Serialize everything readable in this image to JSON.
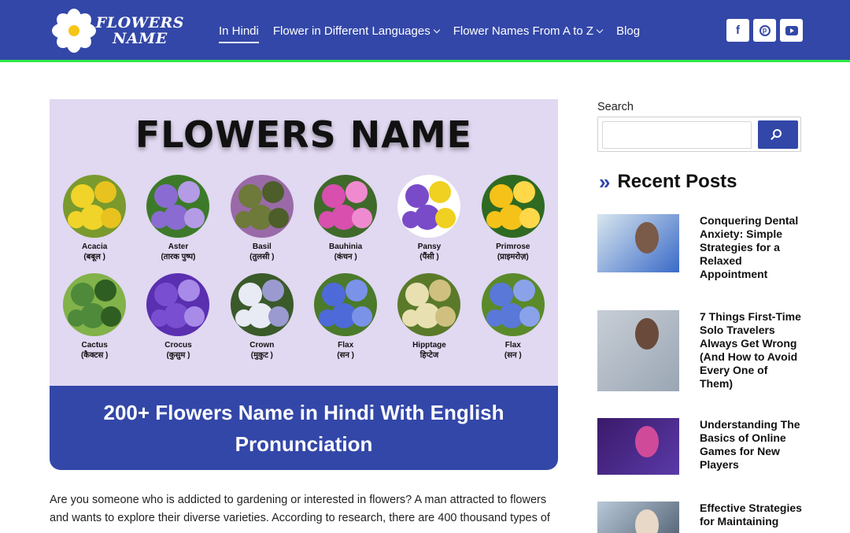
{
  "site": {
    "logo_line1": "FLOWERS",
    "logo_line2": "NAME"
  },
  "nav": {
    "items": [
      {
        "label": "In Hindi",
        "active": true,
        "dropdown": false
      },
      {
        "label": "Flower in Different Languages",
        "dropdown": true
      },
      {
        "label": "Flower Names From A to Z",
        "dropdown": true
      },
      {
        "label": "Blog",
        "dropdown": false
      }
    ]
  },
  "socials": [
    {
      "name": "facebook",
      "glyph": "f"
    },
    {
      "name": "pinterest",
      "glyph": "p"
    },
    {
      "name": "youtube",
      "glyph": ""
    }
  ],
  "hero": {
    "title": "FLOWERS NAME",
    "rows": [
      [
        {
          "name": "Acacia",
          "hindi": "(बबूल )",
          "colors": [
            "#f0d42a",
            "#7a9a2e",
            "#e8c21e"
          ]
        },
        {
          "name": "Aster",
          "hindi": "(तारक पुष्प)",
          "colors": [
            "#8a6bd1",
            "#3c7a2a",
            "#b49be6"
          ]
        },
        {
          "name": "Basil",
          "hindi": "(तुलसी )",
          "colors": [
            "#6d7a3a",
            "#9a6aa8",
            "#4d5e2a"
          ]
        },
        {
          "name": "Bauhinia",
          "hindi": "(कंचन )",
          "colors": [
            "#d84fae",
            "#3f6a2a",
            "#f08ad0"
          ]
        },
        {
          "name": "Pansy",
          "hindi": "(पैंसी )",
          "colors": [
            "#7a4bc8",
            "#ffffff",
            "#f0d020"
          ]
        },
        {
          "name": "Primrose",
          "hindi": "(प्राइमरोज़)",
          "colors": [
            "#f5c21a",
            "#2f6a22",
            "#ffd84a"
          ]
        }
      ],
      [
        {
          "name": "Cactus",
          "hindi": "(कैक्टस )",
          "colors": [
            "#4e8a3a",
            "#82b24a",
            "#2f5e22"
          ]
        },
        {
          "name": "Crocus",
          "hindi": "(कुसुम )",
          "colors": [
            "#7a4ed0",
            "#5a2fb0",
            "#a88ae8"
          ]
        },
        {
          "name": "Crown",
          "hindi": "(मुकुट )",
          "colors": [
            "#e8eaf4",
            "#3a5a2a",
            "#9a9ad0"
          ]
        },
        {
          "name": "Flax",
          "hindi": "(सन )",
          "colors": [
            "#4e6ad8",
            "#4a7a2a",
            "#7a92e8"
          ]
        },
        {
          "name": "Hipptage",
          "hindi": "हिप्टेज",
          "colors": [
            "#e8e0b0",
            "#5a7a2a",
            "#cfc080"
          ]
        },
        {
          "name": "Flax",
          "hindi": "(सन )",
          "colors": [
            "#5a78d8",
            "#5a8a2a",
            "#8aa2ea"
          ]
        }
      ]
    ]
  },
  "article": {
    "title": "200+ Flowers Name in Hindi With English Pronunciation",
    "intro": "Are you someone who is addicted to gardening or interested in flowers? A man attracted to flowers and wants to explore their diverse varieties. According to research, there are 400 thousand types of"
  },
  "sidebar": {
    "search_label": "Search",
    "search_placeholder": "",
    "recent_posts_title": "Recent Posts",
    "posts": [
      {
        "title": "Conquering Dental Anxiety: Simple Strategies for a Relaxed Appointment",
        "colors": [
          "#d8e6ee",
          "#7a5a48",
          "#3a6ac8"
        ]
      },
      {
        "title": "7 Things First-Time Solo Travelers Always Get Wrong (And How to Avoid Every One of Them)",
        "colors": [
          "#c8ced6",
          "#6a4a3a",
          "#9aa6b4"
        ]
      },
      {
        "title": "Understanding The Basics of Online Games for New Players",
        "colors": [
          "#3a1a6a",
          "#d04a9a",
          "#5a3aa8"
        ]
      },
      {
        "title": "Effective Strategies for Maintaining",
        "colors": [
          "#b8c8d8",
          "#e8d8c8",
          "#5a6a7a"
        ]
      }
    ]
  },
  "colors": {
    "brand": "#3347a8",
    "accent_line": "#2ee84a",
    "hero_bg": "#e1d8f1"
  }
}
